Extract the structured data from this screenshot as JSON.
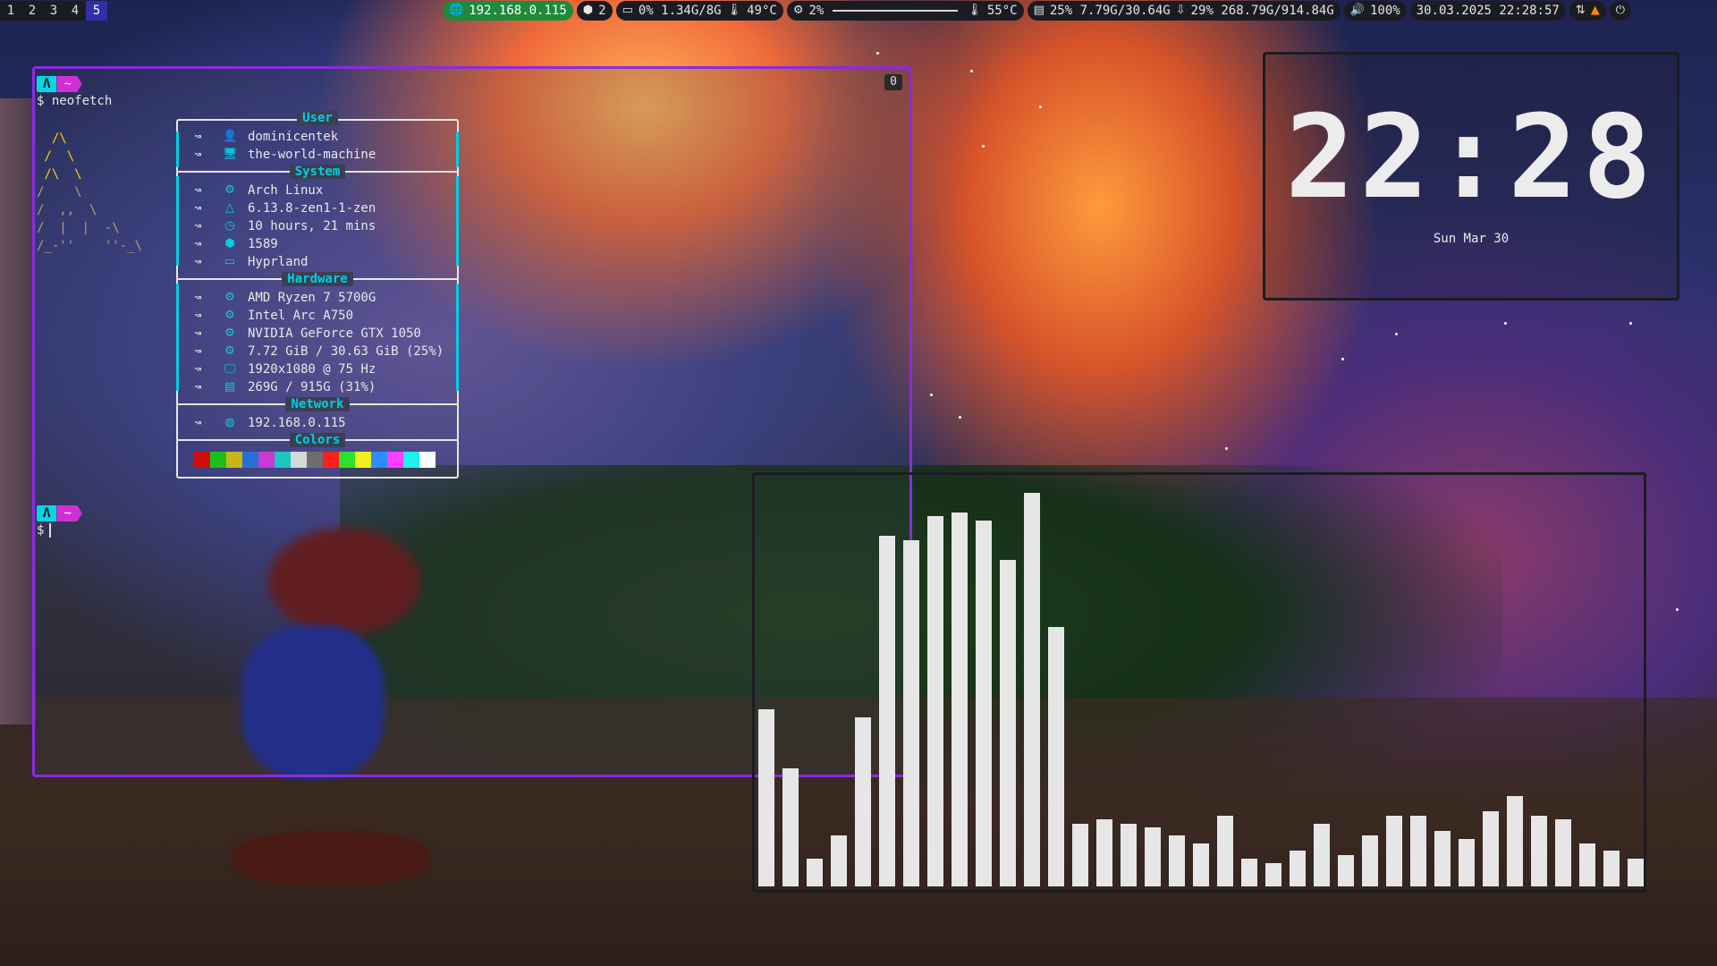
{
  "topbar": {
    "workspaces": [
      "1",
      "2",
      "3",
      "4",
      "5"
    ],
    "active_workspace": "5",
    "network": "192.168.0.115",
    "updates": "2",
    "cpu": "0% 1.34G/8G",
    "cpu_temp": "49°C",
    "gpu": "2%",
    "gpu_temp": "55°C",
    "memory": "25% 7.79G/30.64G",
    "disk": "29% 268.79G/914.84G",
    "volume": "100%",
    "datetime": "30.03.2025 22:28:57",
    "icons": [
      "globe-icon",
      "package-icon",
      "monitor-icon",
      "thermometer-icon",
      "chip-icon",
      "thermometer-icon",
      "memory-icon",
      "download-icon",
      "volume-icon",
      "network-icon",
      "vlc-icon",
      "power-icon"
    ]
  },
  "terminal": {
    "prompt_a": "Λ",
    "prompt_b": "~",
    "command": "$ neofetch",
    "prompt2_line": "$",
    "workspace_badge": "0",
    "logo": [
      "  /\\",
      " /  \\",
      " /\\  \\",
      "/    \\",
      "/  ,,  \\",
      "/  |  |  -\\",
      "/_-''    ''-_\\"
    ],
    "sections": {
      "user": "User",
      "system": "System",
      "hardware": "Hardware",
      "network": "Network",
      "colors": "Colors"
    },
    "arrow": "↝",
    "user_rows": [
      {
        "icon": "user-icon",
        "glyph": "👤",
        "text": "dominicentek"
      },
      {
        "icon": "monitor-icon",
        "glyph": "🖥",
        "text": "the-world-machine"
      }
    ],
    "system_rows": [
      {
        "icon": "arch-icon",
        "glyph": "⚙",
        "text": "Arch Linux"
      },
      {
        "icon": "kernel-icon",
        "glyph": "△",
        "text": "6.13.8-zen1-1-zen"
      },
      {
        "icon": "clock-icon",
        "glyph": "◷",
        "text": "10 hours, 21 mins"
      },
      {
        "icon": "package-icon",
        "glyph": "⬢",
        "text": "1589"
      },
      {
        "icon": "window-icon",
        "glyph": "▭",
        "text": "Hyprland"
      }
    ],
    "hardware_rows": [
      {
        "icon": "cpu-icon",
        "glyph": "⚙",
        "text": "AMD Ryzen 7 5700G"
      },
      {
        "icon": "gpu-icon",
        "glyph": "⚙",
        "text": "Intel Arc A750"
      },
      {
        "icon": "gpu-icon",
        "glyph": "⚙",
        "text": "NVIDIA GeForce GTX 1050"
      },
      {
        "icon": "memory-icon",
        "glyph": "⚙",
        "text": "7.72 GiB / 30.63 GiB (25%)"
      },
      {
        "icon": "display-icon",
        "glyph": "🖵",
        "text": "1920x1080 @ 75 Hz"
      },
      {
        "icon": "disk-icon",
        "glyph": "▤",
        "text": "269G / 915G (31%)"
      }
    ],
    "network_rows": [
      {
        "icon": "globe-icon",
        "glyph": "◍",
        "text": "192.168.0.115"
      }
    ],
    "palette": [
      "#d10b0b",
      "#19c21a",
      "#c9b51a",
      "#2a6fd6",
      "#c83bd0",
      "#1bc6c6",
      "#d8d8d8",
      "#6e6e6e",
      "#ff1f1f",
      "#30e030",
      "#f0f020",
      "#2d8cff",
      "#ff40ff",
      "#20f0f0",
      "#ffffff"
    ]
  },
  "clock": {
    "time": "22:28",
    "date": "Sun Mar 30"
  },
  "visualizer": {
    "levels": [
      0.45,
      0.3,
      0.07,
      0.13,
      0.43,
      0.89,
      0.88,
      0.94,
      0.95,
      0.93,
      0.83,
      1.0,
      0.66,
      0.16,
      0.17,
      0.16,
      0.15,
      0.13,
      0.11,
      0.18,
      0.07,
      0.06,
      0.09,
      0.16,
      0.08,
      0.13,
      0.18,
      0.18,
      0.14,
      0.12,
      0.19,
      0.23,
      0.18,
      0.17,
      0.11,
      0.09,
      0.07
    ]
  }
}
